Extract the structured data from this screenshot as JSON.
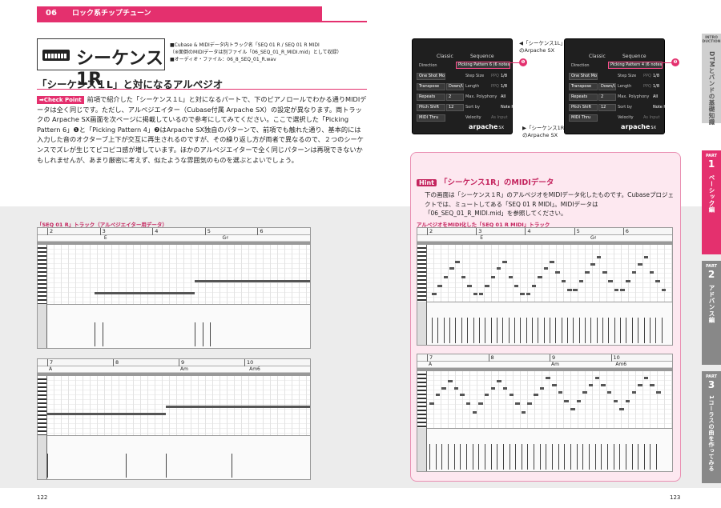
{
  "header": {
    "chapter_number": "06",
    "chapter_title": "ロック系チップチューン"
  },
  "section": {
    "title": "シーケンス1R",
    "meta": [
      "■Cubase & MIDIデータ内トラック名「SEQ 01 R / SEQ 01 R MIDI",
      "（※面倒のMIDIデータは別ファイル「06_SEQ_01_R_MIDI.mid」として収録）",
      "■オーディオ・ファイル：06_8_SEQ_01_R.wav"
    ],
    "subtitle": "「シーケンス１L」と対になるアルペジオ"
  },
  "body": {
    "checkpoint_label": "➡Check Point",
    "paragraph": "前項で紹介した「シーケンス１L」と対になるパートで、下のピアノロールでわかる通りMIDIデータは全く同じです。ただし、アルペジエイター（Cubase付属 Arpache SX）の設定が異なります。両トラックの Arpache SX画面を次ページに掲載しているので参考にしてみてください。ここで選択した「Picking Pattern 6」❶と「Picking Pattern 4」❷はArpache SX独自のパターンで、前項でも触れた通り、基本的には入力した音のオクターブ上下が交互に再生されるのですが、その繰り返し方が両者で異なるので、２つのシーケンスでズレが生じてピコピコ感が増しています。ほかのアルペジエイターで全く同じパターンは再現できないかもしれませんが、あまり厳密に考えず、似たような雰囲気のものを選ぶとよいでしょう。"
  },
  "left_rolls": {
    "caption": "「SEQ 01 R」トラック（アルペジエイター用データ）",
    "roll1": {
      "bars": [
        "2",
        "3",
        "4",
        "5",
        "6"
      ],
      "chords": [
        "E",
        "G♯"
      ]
    },
    "roll2": {
      "bars": [
        "7",
        "8",
        "9",
        "10"
      ],
      "chords": [
        "A",
        "Am",
        "Am6"
      ]
    }
  },
  "arpache": {
    "left": {
      "classic": "Classic",
      "sequence": "Sequence",
      "direction": "Direction",
      "pattern": "Picking Pattern 6 (6 notes)",
      "marker": "❶",
      "caption1": "◀「シーケンス1L」",
      "caption2": "のArpache SX"
    },
    "right": {
      "classic": "Classic",
      "sequence": "Sequence",
      "direction": "Direction",
      "pattern": "Picking Pattern 4 (6 notes)",
      "marker": "❷",
      "caption1": "▶「シーケンス1R」",
      "caption2": "のArpache SX"
    },
    "rows": [
      {
        "a": "One Shot Mode",
        "b": "Step Size",
        "c": "PPQ",
        "d": "1/8"
      },
      {
        "a": "Transpose",
        "v": "Down/Up",
        "b": "Length",
        "c": "PPQ",
        "d": "1/8"
      },
      {
        "a": "Repeats",
        "v": "2",
        "b": "Max. Polyphony",
        "d": "All"
      },
      {
        "a": "Pitch Shift",
        "v": "12",
        "b": "Sort by",
        "d": "Note Highest"
      },
      {
        "a": "MIDI Thru",
        "b": "Velocity",
        "c": "As Input"
      }
    ],
    "logo": "arpache",
    "logo_sx": "SX"
  },
  "hint": {
    "badge": "Hint",
    "title": "「シーケンス1R」のMIDIデータ",
    "text": "下の画面は「シーケンス１R」のアルペジオをMIDIデータ化したものです。Cubaseプロジェクトでは、ミュートしてある「SEQ 01 R MIDI」。MIDIデータは「06_SEQ_01_R_MIDI.mid」を参照してください。",
    "caption": "アルペジオをMIDI化した「SEQ 01 R MIDI」トラック",
    "roll1": {
      "bars": [
        "2",
        "3",
        "4",
        "5",
        "6"
      ],
      "chords": [
        "E",
        "G♯"
      ]
    },
    "roll2": {
      "bars": [
        "7",
        "8",
        "9",
        "10"
      ],
      "chords": [
        "A",
        "Am",
        "Am6"
      ]
    }
  },
  "side_tabs": {
    "intro_label": "INTRO DUCTION",
    "intro_text": "DTMとバンドの基礎知識",
    "parts": [
      {
        "label": "PART",
        "num": "1",
        "text": "ベーシック編"
      },
      {
        "label": "PART",
        "num": "2",
        "text": "アドバンス編"
      },
      {
        "label": "PART",
        "num": "3",
        "text": "1コーラスの曲を作ってみる"
      }
    ]
  },
  "pages": {
    "left": "122",
    "right": "123"
  },
  "colors": {
    "accent": "#e4306e",
    "hint_bg": "#fde8f0"
  }
}
